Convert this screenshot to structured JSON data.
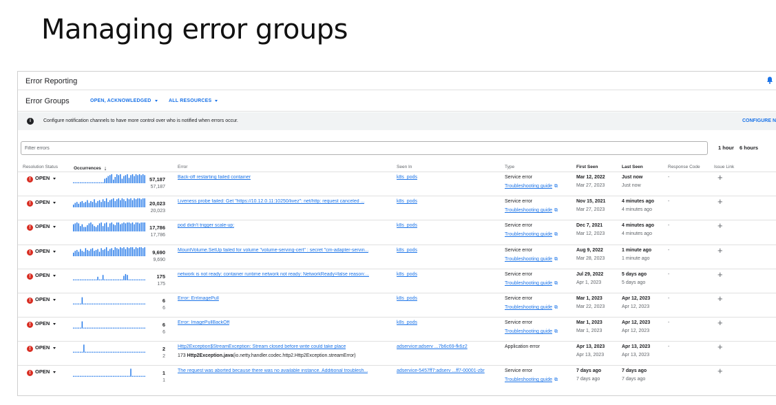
{
  "slide": {
    "title": "Managing error groups"
  },
  "app": {
    "title": "Error Reporting"
  },
  "groups": {
    "title": "Error Groups",
    "status_filter": "OPEN, ACKNOWLEDGED",
    "resource_filter": "ALL RESOURCES"
  },
  "notice": {
    "icon": "info-icon",
    "text": "Configure notification channels to have more control over who is notified when errors occur.",
    "configure": "CONFIGURE N"
  },
  "filter": {
    "placeholder": "Filter errors"
  },
  "time_options": [
    "1 hour",
    "6 hours"
  ],
  "columns": {
    "resolution_status": "Resolution Status",
    "occurrences": "Occurrences",
    "error": "Error",
    "seen_in": "Seen In",
    "type": "Type",
    "first_seen": "First Seen",
    "last_seen": "Last Seen",
    "response_code": "Response Code",
    "issue_link": "Issue Link"
  },
  "colors": {
    "accent": "#1a73e8",
    "error": "#d93025",
    "spark": "#1a73e8"
  },
  "rows": [
    {
      "status": "OPEN",
      "count": "57,187",
      "count_sub": "57,187",
      "error": "Back-off restarting failed container",
      "seen_in": "k8s_pods",
      "type": "Service error",
      "guide": "Troubleshooting guide",
      "first_seen": "Mar 12, 2022",
      "first_seen_sub": "Mar 27, 2023",
      "last_seen": "Just now",
      "last_seen_sub": "Just now",
      "response": "-",
      "spark": [
        0.1,
        0.1,
        0.1,
        0.1,
        0.1,
        0.1,
        0.1,
        0.1,
        0.1,
        0.1,
        0.1,
        0.1,
        0.1,
        0.1,
        0.1,
        0.1,
        0.1,
        0.1,
        0.5,
        0.6,
        0.8,
        0.9,
        1,
        0.4,
        0.7,
        1,
        0.9,
        1,
        0.5,
        0.8,
        0.9,
        1,
        0.6,
        0.9,
        1,
        0.8,
        1,
        0.9,
        1,
        0.9,
        1,
        0.9
      ]
    },
    {
      "status": "OPEN",
      "count": "20,023",
      "count_sub": "20,023",
      "error": "Liveness probe failed: Get \"https://10.12.0.11:10250/livez\": net/http: request canceled ...",
      "seen_in": "k8s_pods",
      "type": "Service error",
      "guide": "Troubleshooting guide",
      "first_seen": "Nov 15, 2021",
      "first_seen_sub": "Mar 27, 2023",
      "last_seen": "4 minutes ago",
      "last_seen_sub": "4 minutes ago",
      "response": "-",
      "spark": [
        0.3,
        0.5,
        0.6,
        0.4,
        0.6,
        0.7,
        0.5,
        0.6,
        0.8,
        0.5,
        0.7,
        0.6,
        0.9,
        0.5,
        0.7,
        0.8,
        0.6,
        0.9,
        0.7,
        1,
        0.6,
        0.8,
        0.9,
        1,
        0.7,
        0.9,
        1,
        0.8,
        1,
        0.9,
        0.7,
        1,
        0.9,
        1,
        0.8,
        1,
        0.9,
        1,
        1,
        0.9,
        1,
        1
      ]
    },
    {
      "status": "OPEN",
      "count": "17,786",
      "count_sub": "17,786",
      "error": "pod didn't trigger scale-up:",
      "seen_in": "k8s_pods",
      "type": "Service error",
      "guide": "Troubleshooting guide",
      "first_seen": "Dec 7, 2021",
      "first_seen_sub": "Mar 12, 2023",
      "last_seen": "4 minutes ago",
      "last_seen_sub": "4 minutes ago",
      "response": "-",
      "spark": [
        0.8,
        0.9,
        1,
        0.9,
        0.6,
        0.8,
        0.5,
        0.5,
        0.7,
        0.9,
        1,
        0.8,
        0.6,
        0.5,
        0.7,
        0.9,
        1,
        0.6,
        0.9,
        1,
        0.5,
        0.9,
        1,
        0.8,
        0.7,
        1,
        1,
        0.8,
        0.9,
        1,
        0.9,
        1,
        1,
        0.9,
        1,
        0.8,
        1,
        1,
        0.9,
        1,
        1,
        1
      ]
    },
    {
      "status": "OPEN",
      "count": "9,690",
      "count_sub": "9,690",
      "error": "MountVolume.SetUp failed for volume \"volume-serving-cert\" : secret \"cm-adapter-servin...",
      "seen_in": "k8s_pods",
      "type": "Service error",
      "guide": "Troubleshooting guide",
      "first_seen": "Aug 9, 2022",
      "first_seen_sub": "Mar 28, 2023",
      "last_seen": "1 minute ago",
      "last_seen_sub": "1 minute ago",
      "response": "-",
      "spark": [
        0.4,
        0.6,
        0.7,
        0.5,
        0.8,
        0.6,
        0.5,
        0.9,
        0.7,
        0.6,
        0.8,
        0.9,
        0.6,
        0.7,
        0.8,
        0.5,
        0.9,
        0.7,
        0.8,
        1,
        0.6,
        0.8,
        0.9,
        0.7,
        1,
        0.9,
        0.8,
        1,
        0.9,
        1,
        0.8,
        1,
        0.9,
        1,
        1,
        0.8,
        1,
        0.9,
        1,
        1,
        0.9,
        1
      ]
    },
    {
      "status": "OPEN",
      "count": "175",
      "count_sub": "175",
      "error": "network is not ready: container runtime network not ready: NetworkReady=false reason:...",
      "seen_in": "k8s_pods",
      "type": "Service error",
      "guide": "Troubleshooting guide",
      "first_seen": "Jul 29, 2022",
      "first_seen_sub": "Apr 1, 2023",
      "last_seen": "5 days ago",
      "last_seen_sub": "5 days ago",
      "response": "-",
      "spark": [
        0.1,
        0.1,
        0.1,
        0.1,
        0.1,
        0.1,
        0.1,
        0.1,
        0.1,
        0.1,
        0.1,
        0.1,
        0.1,
        0.1,
        0.4,
        0.1,
        0.1,
        0.6,
        0.1,
        0.1,
        0.1,
        0.1,
        0.1,
        0.1,
        0.1,
        0.1,
        0.1,
        0.1,
        0.1,
        0.5,
        0.7,
        0.6,
        0.1,
        0.1,
        0.1,
        0.1,
        0.1,
        0.1,
        0.1,
        0.1,
        0.1,
        0.1
      ]
    },
    {
      "status": "OPEN",
      "count": "6",
      "count_sub": "6",
      "error": "Error: ErrImagePull",
      "seen_in": "k8s_pods",
      "type": "Service error",
      "guide": "Troubleshooting guide",
      "first_seen": "Mar 1, 2023",
      "first_seen_sub": "Mar 22, 2023",
      "last_seen": "Apr 12, 2023",
      "last_seen_sub": "Apr 12, 2023",
      "response": "-",
      "spark": [
        0.1,
        0.1,
        0.1,
        0.1,
        0.1,
        0.8,
        0.1,
        0.1,
        0.1,
        0.1,
        0.1,
        0.1,
        0.1,
        0.1,
        0.1,
        0.1,
        0.1,
        0.1,
        0.1,
        0.1,
        0.1,
        0.1,
        0.1,
        0.1,
        0.1,
        0.1,
        0.1,
        0.1,
        0.1,
        0.1,
        0.1,
        0.1,
        0.1,
        0.1,
        0.1,
        0.1,
        0.1,
        0.1,
        0.1,
        0.1,
        0.1,
        0.1
      ]
    },
    {
      "status": "OPEN",
      "count": "6",
      "count_sub": "6",
      "error": "Error: ImagePullBackOff",
      "seen_in": "k8s_pods",
      "type": "Service error",
      "guide": "Troubleshooting guide",
      "first_seen": "Mar 1, 2023",
      "first_seen_sub": "Mar 1, 2023",
      "last_seen": "Apr 12, 2023",
      "last_seen_sub": "Apr 12, 2023",
      "response": "-",
      "spark": [
        0.1,
        0.1,
        0.1,
        0.1,
        0.1,
        0.8,
        0.1,
        0.1,
        0.1,
        0.1,
        0.1,
        0.1,
        0.1,
        0.1,
        0.1,
        0.1,
        0.1,
        0.1,
        0.1,
        0.1,
        0.1,
        0.1,
        0.1,
        0.1,
        0.1,
        0.1,
        0.1,
        0.1,
        0.1,
        0.1,
        0.1,
        0.1,
        0.1,
        0.1,
        0.1,
        0.1,
        0.1,
        0.1,
        0.1,
        0.1,
        0.1,
        0.1
      ]
    },
    {
      "status": "OPEN",
      "count": "2",
      "count_sub": "2",
      "error": "Http2Exception$StreamException: Stream closed before write could take place",
      "error_sub_prefix": "173",
      "error_sub_bold": "Http2Exception.java",
      "error_sub_rest": "(io.netty.handler.codec.http2.Http2Exception.streamError)",
      "seen_in": "adservice:adserv ...7b6c69-fk6z2",
      "type": "Application error",
      "guide": "",
      "first_seen": "Apr 13, 2023",
      "first_seen_sub": "Apr 13, 2023",
      "last_seen": "Apr 13, 2023",
      "last_seen_sub": "Apr 13, 2023",
      "response": "-",
      "spark": [
        0.1,
        0.1,
        0.1,
        0.1,
        0.1,
        0.1,
        0.9,
        0.1,
        0.1,
        0.1,
        0.1,
        0.1,
        0.1,
        0.1,
        0.1,
        0.1,
        0.1,
        0.1,
        0.1,
        0.1,
        0.1,
        0.1,
        0.1,
        0.1,
        0.1,
        0.1,
        0.1,
        0.1,
        0.1,
        0.1,
        0.1,
        0.1,
        0.1,
        0.1,
        0.1,
        0.1,
        0.1,
        0.1,
        0.1,
        0.1,
        0.1,
        0.1
      ]
    },
    {
      "status": "OPEN",
      "count": "1",
      "count_sub": "1",
      "error": "The request was aborted because there was no available instance. Additional troublesh...",
      "seen_in": "adservice-5457ff7:adserv ...ff7-00001-zbr",
      "type": "Service error",
      "guide": "Troubleshooting guide",
      "first_seen": "7 days ago",
      "first_seen_sub": "7 days ago",
      "last_seen": "7 days ago",
      "last_seen_sub": "7 days ago",
      "response": "",
      "spark": [
        0.1,
        0.1,
        0.1,
        0.1,
        0.1,
        0.1,
        0.1,
        0.1,
        0.1,
        0.1,
        0.1,
        0.1,
        0.1,
        0.1,
        0.1,
        0.1,
        0.1,
        0.1,
        0.1,
        0.1,
        0.1,
        0.1,
        0.1,
        0.1,
        0.1,
        0.1,
        0.1,
        0.1,
        0.1,
        0.1,
        0.1,
        0.1,
        0.1,
        0.9,
        0.1,
        0.1,
        0.1,
        0.1,
        0.1,
        0.1,
        0.1,
        0.1
      ]
    }
  ]
}
